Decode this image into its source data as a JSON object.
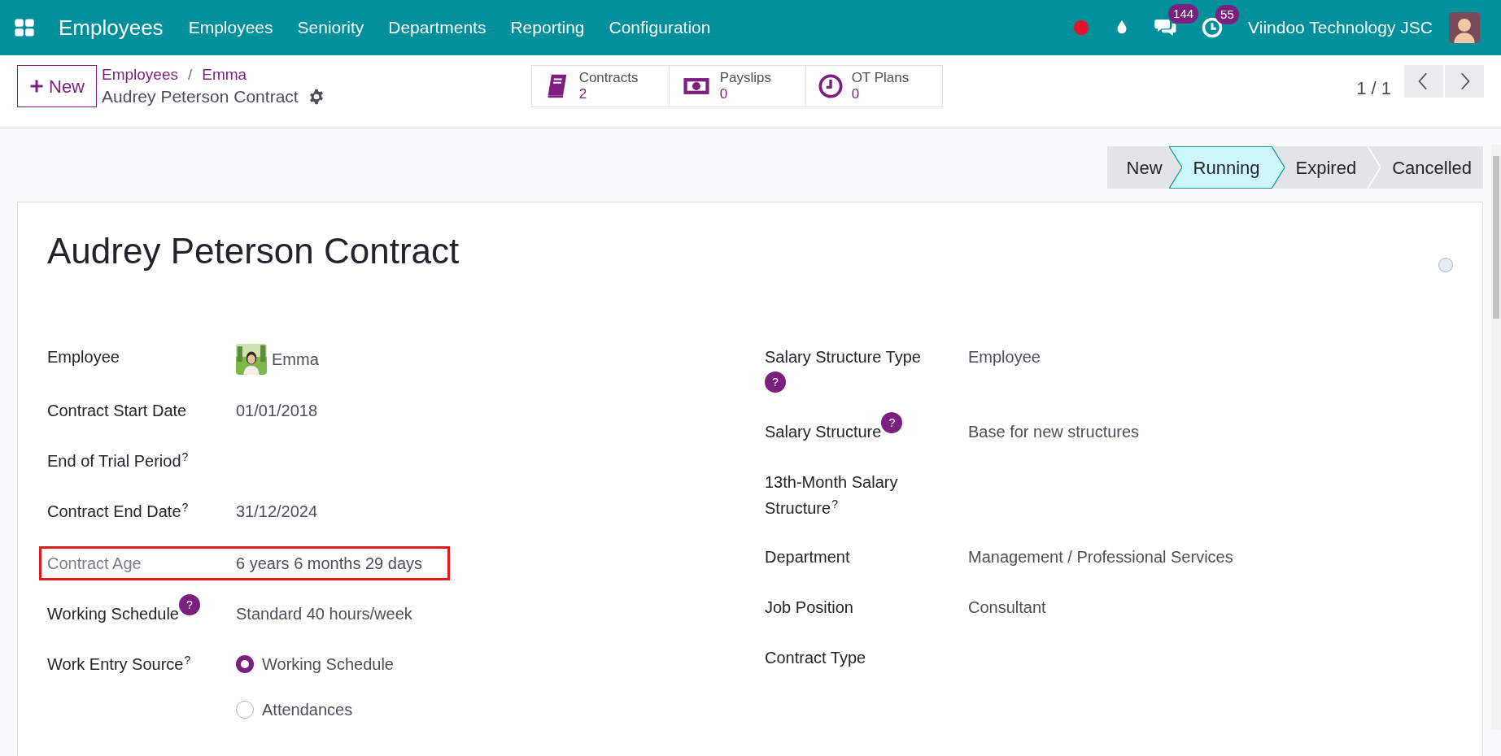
{
  "navbar": {
    "app_name": "Employees",
    "menu": [
      "Employees",
      "Seniority",
      "Departments",
      "Reporting",
      "Configuration"
    ],
    "systray": [
      {
        "kind": "record"
      },
      {
        "kind": "drop"
      },
      {
        "kind": "chat",
        "badge": "144"
      },
      {
        "kind": "activity",
        "badge": "55"
      }
    ],
    "company": "Viindoo Technology JSC"
  },
  "control_panel": {
    "new_button": "New",
    "breadcrumbs": [
      "Employees",
      "Emma"
    ],
    "breadcrumb_separator": "/",
    "record_name": "Audrey Peterson Contract",
    "smart_buttons": [
      {
        "kind": "book",
        "label": "Contracts",
        "count": "2"
      },
      {
        "kind": "money",
        "label": "Payslips",
        "count": "0"
      },
      {
        "kind": "clock",
        "label": "OT Plans",
        "count": "0"
      }
    ],
    "pager": "1 / 1"
  },
  "statusbar": [
    {
      "label": "New",
      "selected": false
    },
    {
      "label": "Running",
      "selected": true
    },
    {
      "label": "Expired",
      "selected": false
    },
    {
      "label": "Cancelled",
      "selected": false
    }
  ],
  "form": {
    "title": "Audrey Peterson Contract",
    "left_fields": [
      {
        "label": "Employee",
        "kind": "avatar",
        "value": "Emma"
      },
      {
        "label": "Contract Start Date",
        "kind": "text",
        "value": "01/01/2018"
      },
      {
        "label": "End of Trial Period",
        "help": {
          "kind": "sup",
          "text": "?"
        },
        "kind": "text"
      },
      {
        "label": "Contract End Date",
        "help": {
          "kind": "sup",
          "text": "?"
        },
        "kind": "text",
        "value": "31/12/2024"
      },
      {
        "label": "Contract Age",
        "kind": "text",
        "value": "6 years 6 months 29 days",
        "readonly": true,
        "highlighted": true
      },
      {
        "label": "Working Schedule",
        "help": {
          "kind": "badge",
          "text": "?"
        },
        "kind": "text",
        "value": "Standard 40 hours/week"
      },
      {
        "label": "Work Entry Source",
        "help": {
          "kind": "sup",
          "text": "?"
        },
        "kind": "radio",
        "options": [
          {
            "label": "Working Schedule",
            "selected": true
          },
          {
            "label": "Attendances",
            "selected": false
          }
        ]
      }
    ],
    "right_fields": [
      {
        "label": "Salary Structure Type",
        "help": {
          "kind": "badge-below",
          "text": "?"
        },
        "kind": "text",
        "value": "Employee"
      },
      {
        "label": "Salary Structure",
        "help": {
          "kind": "badge",
          "text": "?"
        },
        "kind": "text",
        "value": "Base for new structures"
      },
      {
        "label": "13th-Month Salary Structure",
        "help": {
          "kind": "sup",
          "text": "?"
        },
        "kind": "text"
      },
      {
        "label": "Department",
        "kind": "text",
        "value": "Management / Professional Services"
      },
      {
        "label": "Job Position",
        "kind": "text",
        "value": "Consultant"
      },
      {
        "label": "Contract Type",
        "kind": "text"
      }
    ]
  }
}
